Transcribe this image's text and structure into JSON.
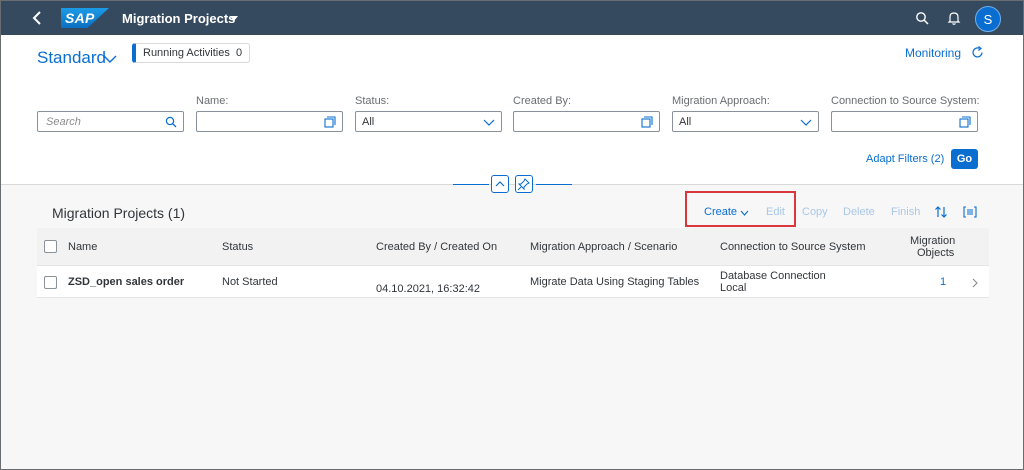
{
  "shell": {
    "logo_text": "SAP",
    "title": "Migration Projects",
    "avatar_initial": "S"
  },
  "header": {
    "variant": "Standard",
    "running_label": "Running Activities",
    "running_count": "0",
    "monitoring": "Monitoring"
  },
  "filters": {
    "search_placeholder": "Search",
    "name_label": "Name:",
    "name_value": "",
    "status_label": "Status:",
    "status_value": "All",
    "created_by_label": "Created By:",
    "created_by_value": "",
    "approach_label": "Migration Approach:",
    "approach_value": "All",
    "connection_label": "Connection to Source System:",
    "connection_value": "",
    "adapt_filters": "Adapt Filters (2)",
    "go": "Go"
  },
  "toolbar": {
    "title": "Migration Projects (1)",
    "create": "Create",
    "edit": "Edit",
    "copy": "Copy",
    "delete": "Delete",
    "finish": "Finish"
  },
  "table": {
    "columns": {
      "name": "Name",
      "status": "Status",
      "created": "Created By / Created On",
      "approach": "Migration Approach / Scenario",
      "connection": "Connection to Source System",
      "objects_line1": "Migration",
      "objects_line2": "Objects"
    },
    "rows": [
      {
        "name": "ZSD_open sales order",
        "status": "Not Started",
        "created_on": "04.10.2021, 16:32:42",
        "approach": "Migrate Data Using Staging Tables",
        "connection_line1": "Database Connection",
        "connection_line2": "Local",
        "objects": "1"
      }
    ]
  },
  "colors": {
    "shell": "#354a5f",
    "accent": "#0a6ed1",
    "highlight": "#d9363e"
  }
}
